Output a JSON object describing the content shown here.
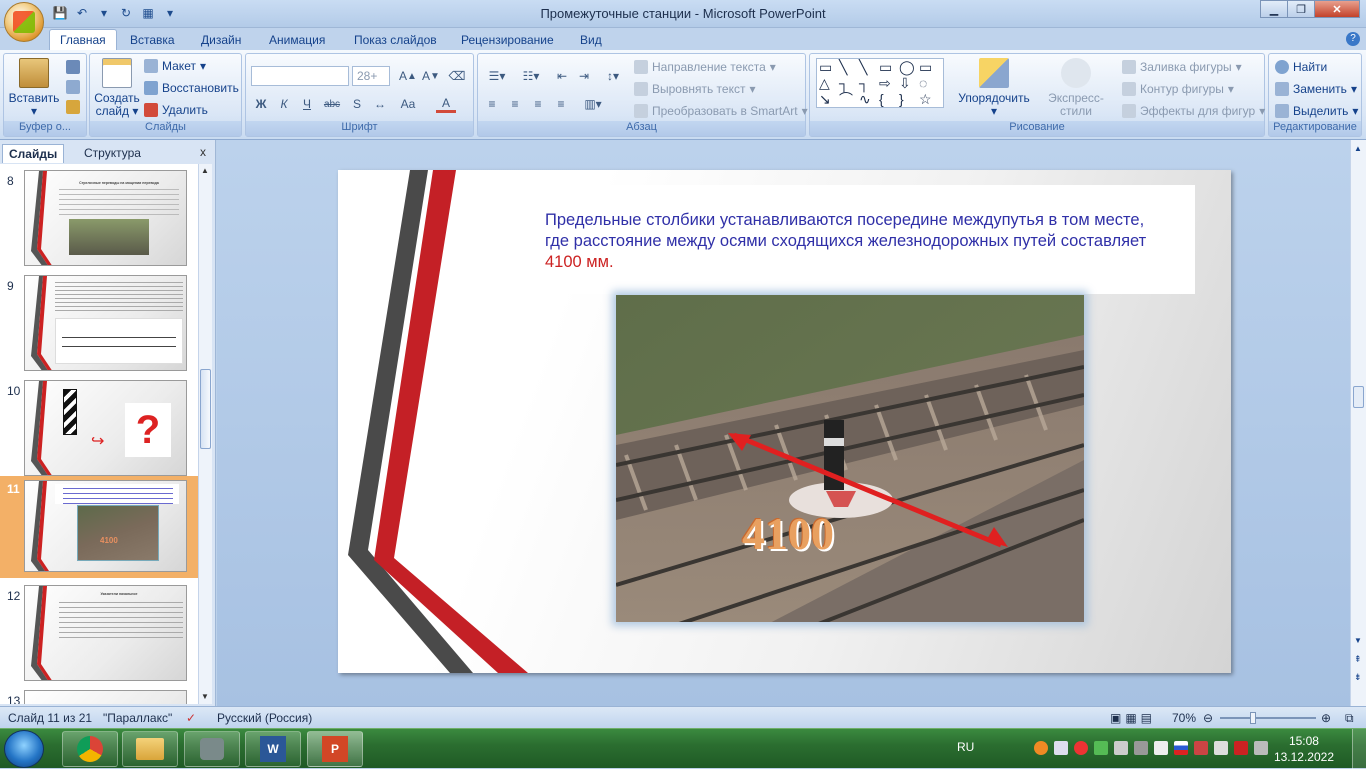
{
  "window": {
    "title": "Промежуточные станции - Microsoft PowerPoint"
  },
  "tabs": [
    "Главная",
    "Вставка",
    "Дизайн",
    "Анимация",
    "Показ слайдов",
    "Рецензирование",
    "Вид"
  ],
  "ribbon": {
    "clipboard": {
      "paste": "Вставить",
      "label": "Буфер о..."
    },
    "slides": {
      "new_slide": "Создать слайд",
      "layout": "Макет",
      "reset": "Восстановить",
      "delete": "Удалить",
      "label": "Слайды"
    },
    "font": {
      "size": "28+",
      "label": "Шрифт",
      "bold": "Ж",
      "italic": "К",
      "underline": "Ч",
      "strike": "abc",
      "shadow": "S",
      "case": "Aa"
    },
    "paragraph": {
      "direction": "Направление текста",
      "align": "Выровнять текст",
      "smartart": "Преобразовать в SmartArt",
      "label": "Абзац"
    },
    "drawing": {
      "arrange": "Упорядочить",
      "quick_styles": "Экспресс-стили",
      "fill": "Заливка фигуры",
      "outline": "Контур фигуры",
      "effects": "Эффекты для фигур",
      "label": "Рисование"
    },
    "editing": {
      "find": "Найти",
      "replace": "Заменить",
      "select": "Выделить",
      "label": "Редактирование"
    }
  },
  "panel": {
    "tab_slides": "Слайды",
    "tab_outline": "Структура",
    "close": "x"
  },
  "thumbs": [
    {
      "num": "8",
      "title": "Стрелочные переводы на мощении перевода"
    },
    {
      "num": "9",
      "title": ""
    },
    {
      "num": "10",
      "title": ""
    },
    {
      "num": "11",
      "title": ""
    },
    {
      "num": "12",
      "title": "Указатели начальное"
    },
    {
      "num": "13",
      "title": ""
    }
  ],
  "slide": {
    "text_part1": "Предельные столбики устанавливаются посередине междупутья в том месте, где расстояние между осями сходящихся железнодорожных путей составляет ",
    "text_red": "4100 мм.",
    "photo_label": "4100",
    "colors": {
      "text": "#3030a8",
      "accent": "#cc2222"
    }
  },
  "status": {
    "slide": "Слайд 11 из 21",
    "theme": "\"Параллакс\"",
    "lang": "Русский (Россия)",
    "zoom": "70%"
  },
  "taskbar": {
    "lang": "RU",
    "time": "15:08",
    "date": "13.12.2022"
  }
}
